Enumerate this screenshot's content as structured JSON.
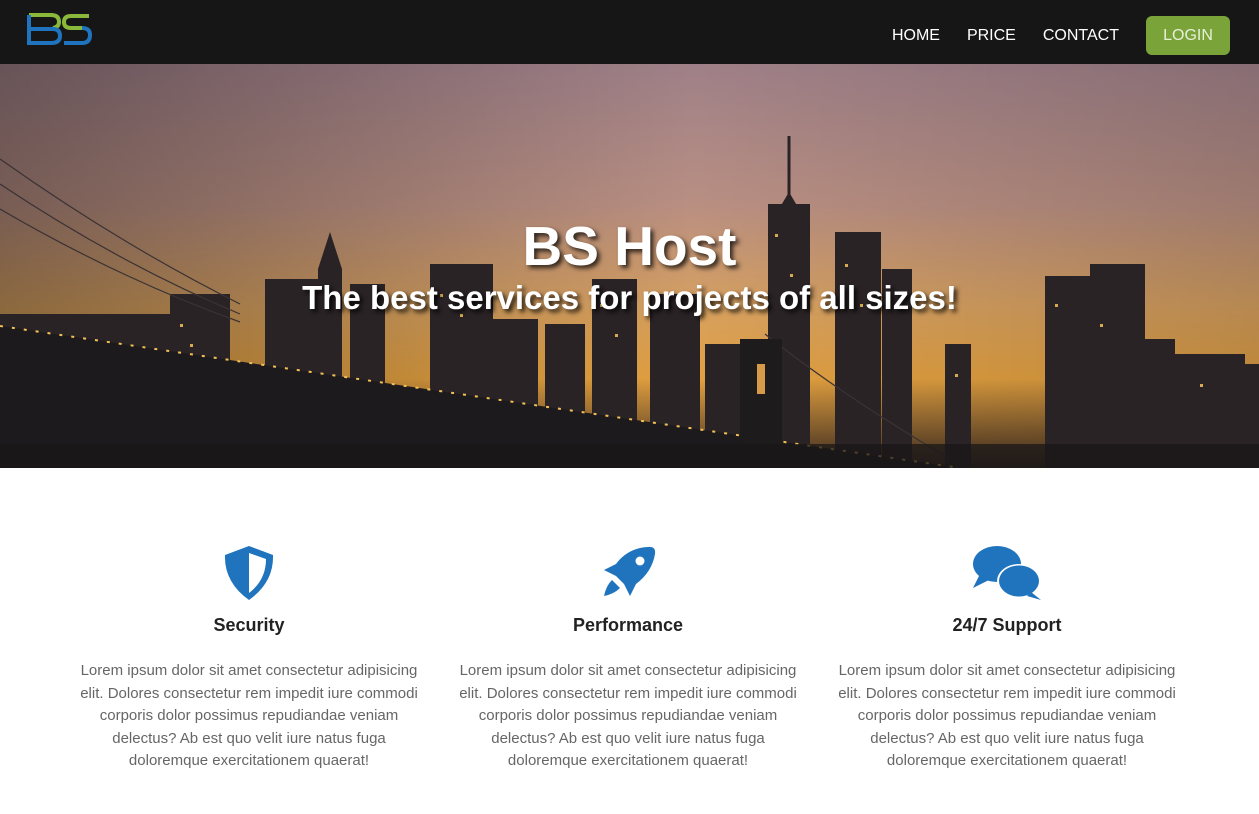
{
  "nav": {
    "logo_text": "BS",
    "links": [
      "HOME",
      "PRICE",
      "CONTACT"
    ],
    "login_label": "LOGIN"
  },
  "hero": {
    "title": "BS Host",
    "subtitle": "The best services for projects of all sizes!"
  },
  "features": [
    {
      "icon": "shield-icon",
      "title": "Security",
      "text": "Lorem ipsum dolor sit amet consectetur adipisicing elit. Dolores consectetur rem impedit iure commodi corporis dolor possimus repudiandae veniam delectus? Ab est quo velit iure natus fuga doloremque exercitationem quaerat!"
    },
    {
      "icon": "rocket-icon",
      "title": "Performance",
      "text": "Lorem ipsum dolor sit amet consectetur adipisicing elit. Dolores consectetur rem impedit iure commodi corporis dolor possimus repudiandae veniam delectus? Ab est quo velit iure natus fuga doloremque exercitationem quaerat!"
    },
    {
      "icon": "chat-bubbles-icon",
      "title": "24/7 Support",
      "text": "Lorem ipsum dolor sit amet consectetur adipisicing elit. Dolores consectetur rem impedit iure commodi corporis dolor possimus repudiandae veniam delectus? Ab est quo velit iure natus fuga doloremque exercitationem quaerat!"
    }
  ],
  "colors": {
    "navbar_bg": "#161616",
    "login_btn": "#7aa33a",
    "icon_blue": "#1f74bd",
    "logo_green": "#8ab83a",
    "logo_blue": "#1f74bd"
  }
}
